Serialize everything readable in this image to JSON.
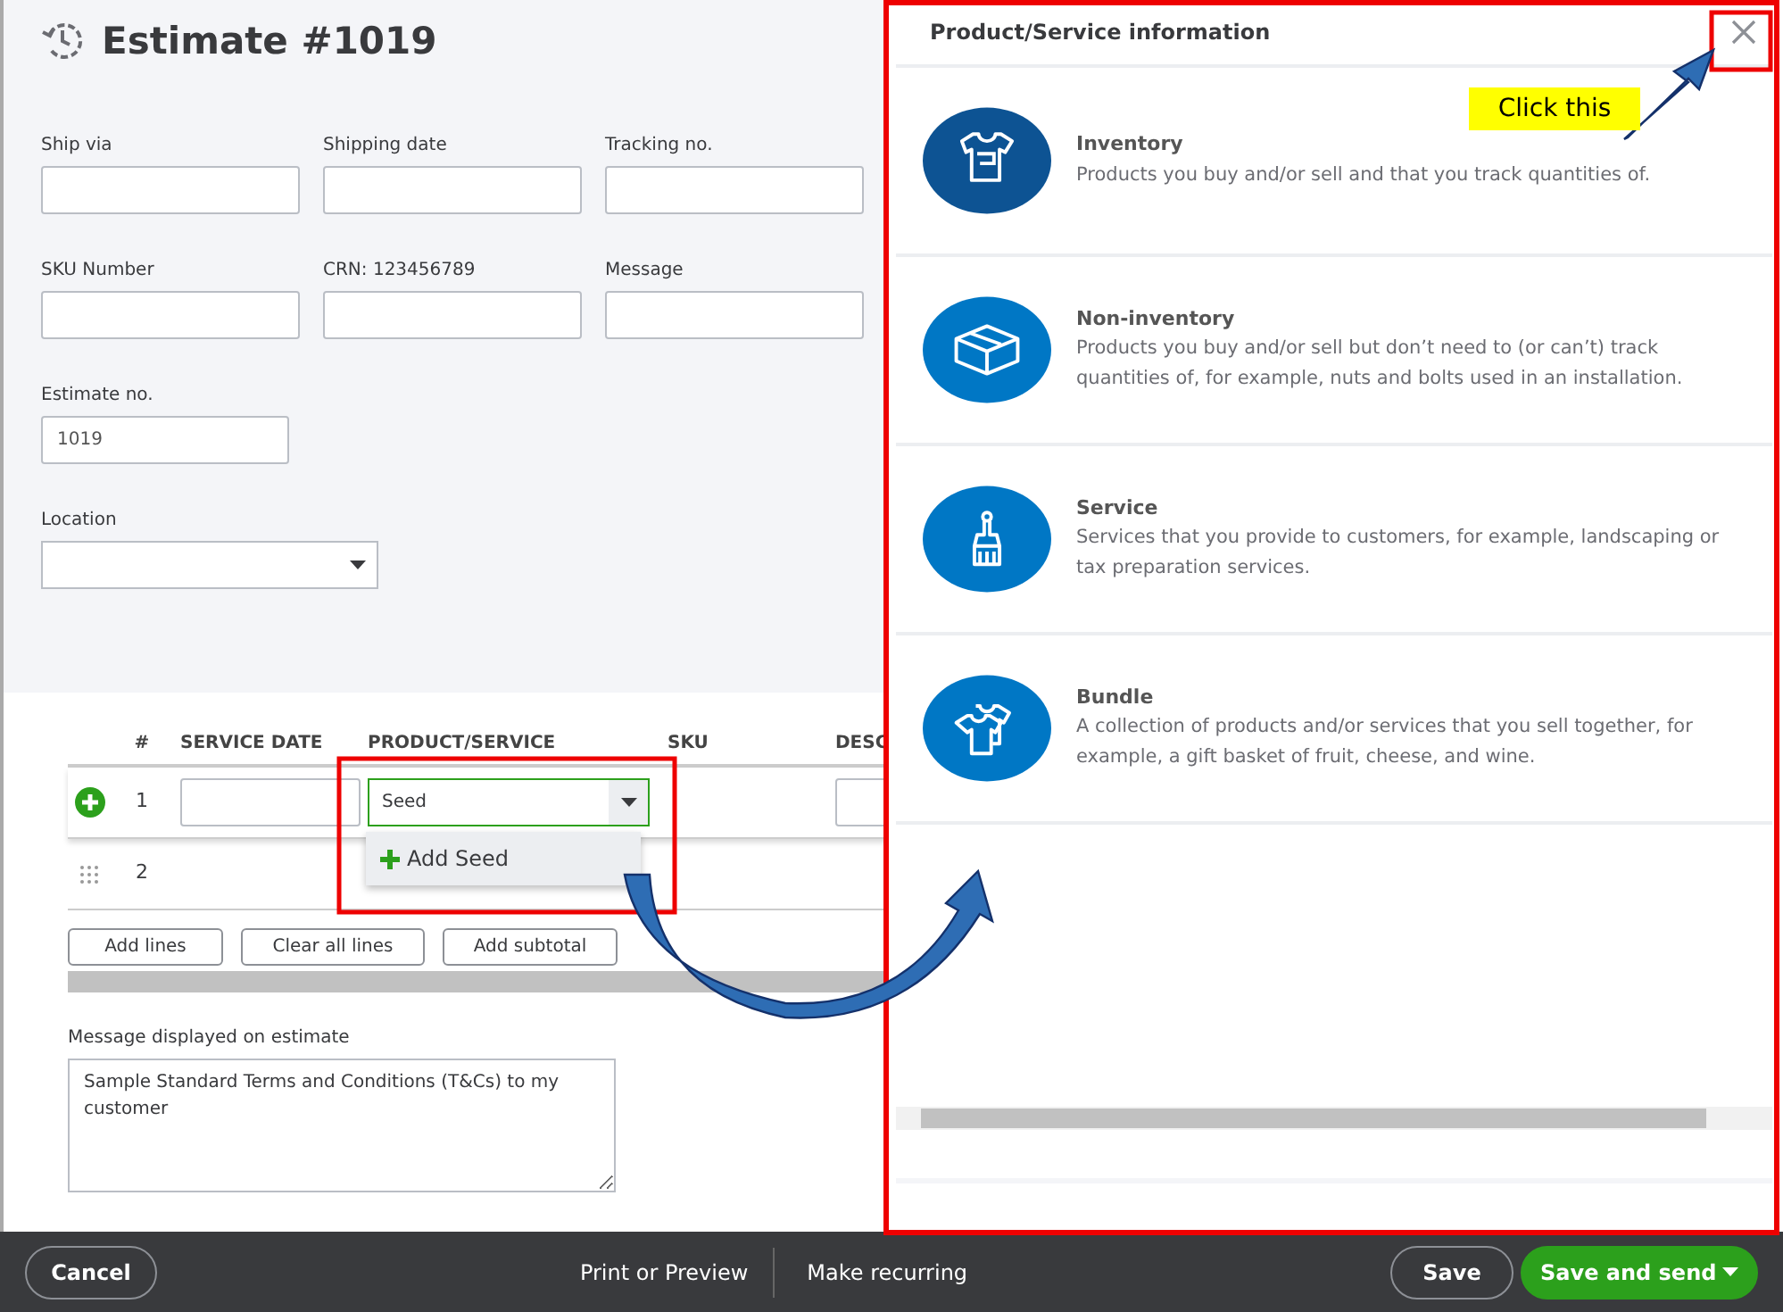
{
  "title": "Estimate #1019",
  "fields": [
    {
      "label": "Ship via"
    },
    {
      "label": "Shipping date"
    },
    {
      "label": "Tracking no."
    },
    {
      "label": "SKU Number"
    },
    {
      "label": "CRN: 123456789"
    },
    {
      "label": "Message"
    }
  ],
  "estimate_no": {
    "label": "Estimate no.",
    "value": "1019"
  },
  "location": {
    "label": "Location"
  },
  "table": {
    "columns": [
      "#",
      "SERVICE DATE",
      "PRODUCT/SERVICE",
      "SKU",
      "DESC"
    ],
    "rows": [
      {
        "number": "1",
        "kind": "editing",
        "product": "Seed",
        "suggestion": "Add Seed"
      },
      {
        "number": "2",
        "kind": "idle"
      }
    ]
  },
  "table_buttons": [
    "Add lines",
    "Clear all lines",
    "Add subtotal"
  ],
  "message": {
    "label": "Message displayed on estimate",
    "value": "Sample Standard Terms and Conditions (T&Cs) to my customer"
  },
  "panel": {
    "title": "Product/Service information",
    "items": [
      {
        "kind": "inventory",
        "selected": true,
        "name": "Inventory",
        "description": "Products you buy and/or sell and that you track quantities of."
      },
      {
        "kind": "non_inventory",
        "selected": false,
        "name": "Non-inventory",
        "description": "Products you buy and/or sell but don’t need to (or can’t) track quantities of, for example, nuts and bolts used in an installation."
      },
      {
        "kind": "service",
        "selected": false,
        "name": "Service",
        "description": "Services that you provide to customers, for example, landscaping or tax preparation services."
      },
      {
        "kind": "bundle",
        "selected": false,
        "name": "Bundle",
        "description": "A collection of products and/or services that you sell together, for example, a gift basket of fruit, cheese, and wine."
      }
    ]
  },
  "callout": "Click this",
  "footer": {
    "cancel": "Cancel",
    "print": "Print or Preview",
    "recurring": "Make recurring",
    "save": "Save",
    "save_send": "Save and send"
  }
}
